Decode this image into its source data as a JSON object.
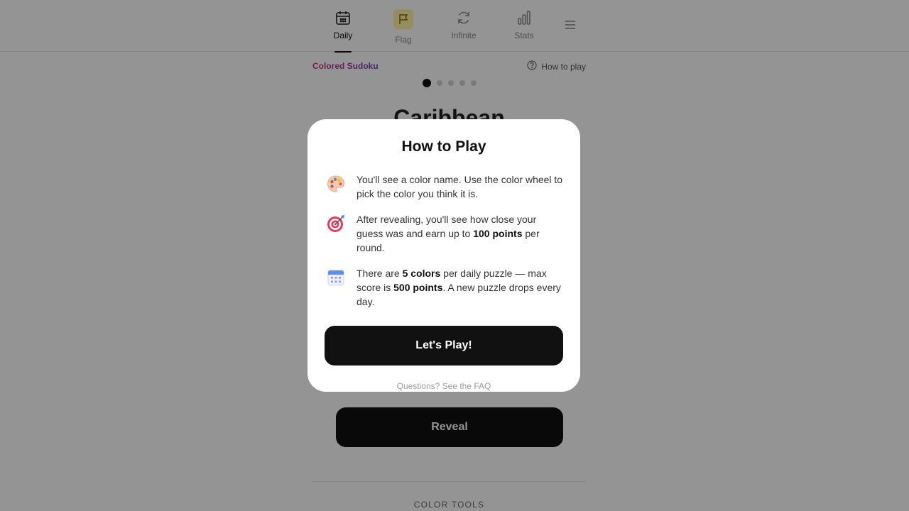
{
  "nav": {
    "items": [
      {
        "label": "Daily",
        "icon": "calendar-icon",
        "active": true
      },
      {
        "label": "Flag",
        "icon": "flag-icon",
        "active": false
      },
      {
        "label": "Infinite",
        "icon": "refresh-icon",
        "active": false
      },
      {
        "label": "Stats",
        "icon": "bar-chart-icon",
        "active": false
      }
    ],
    "menu_icon": "hamburger-menu-icon"
  },
  "subheader": {
    "brand": "Colored Sudoku",
    "how_to_play": "How to play"
  },
  "progress": {
    "current": 1,
    "total": 5
  },
  "game": {
    "color_name": "Caribbean",
    "reveal_label": "Reveal",
    "tools_title": "COLOR TOOLS"
  },
  "modal": {
    "title": "How to Play",
    "rules": [
      {
        "icon": "palette-icon",
        "parts": [
          {
            "t": "You'll see a color name. Use the color wheel to pick the color you think it is.",
            "b": false
          }
        ]
      },
      {
        "icon": "target-icon",
        "parts": [
          {
            "t": "After revealing, you'll see how close your guess was and earn up to ",
            "b": false
          },
          {
            "t": "100 points",
            "b": true
          },
          {
            "t": " per round.",
            "b": false
          }
        ]
      },
      {
        "icon": "calendar-icon",
        "parts": [
          {
            "t": "There are ",
            "b": false
          },
          {
            "t": "5 colors",
            "b": true
          },
          {
            "t": " per daily puzzle — max score is ",
            "b": false
          },
          {
            "t": "500 points",
            "b": true
          },
          {
            "t": ". A new puzzle drops every day.",
            "b": false
          }
        ]
      }
    ],
    "play_label": "Let's Play!",
    "faq": "Questions? See the FAQ"
  },
  "colors": {
    "accent_start": "#d63384",
    "accent_end": "#6f42c1",
    "button_bg": "#111111",
    "flag_highlight": "#fff3a6"
  }
}
